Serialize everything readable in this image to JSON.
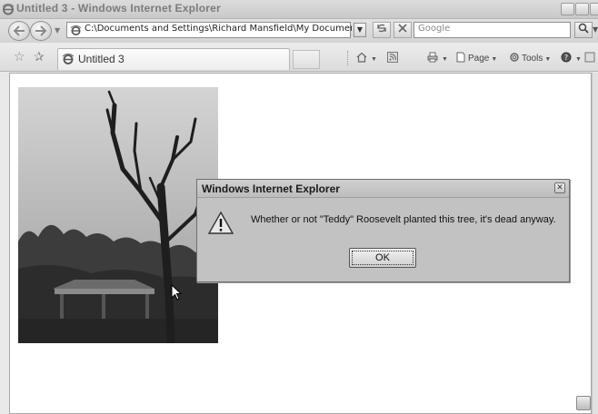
{
  "window": {
    "title": "Untitled 3 - Windows Internet Explorer"
  },
  "address_bar": {
    "url": "C:\\Documents and Settings\\Richard Mansfield\\My Documents\\My Web",
    "search_placeholder": "Google"
  },
  "tabs": [
    {
      "label": "Untitled 3"
    }
  ],
  "command_bar": {
    "page_label": "Page",
    "tools_label": "Tools"
  },
  "dialog": {
    "title": "Windows Internet Explorer",
    "message": "Whether or not \"Teddy\" Roosevelt planted this tree, it's dead anyway.",
    "ok_label": "OK"
  },
  "icons": {
    "back": "back-arrow-icon",
    "forward": "forward-arrow-icon",
    "refresh": "refresh-icon",
    "stop": "stop-icon",
    "search": "magnifier-icon",
    "home": "home-icon",
    "feeds": "feeds-icon",
    "print": "print-icon",
    "warning": "warning-icon"
  }
}
